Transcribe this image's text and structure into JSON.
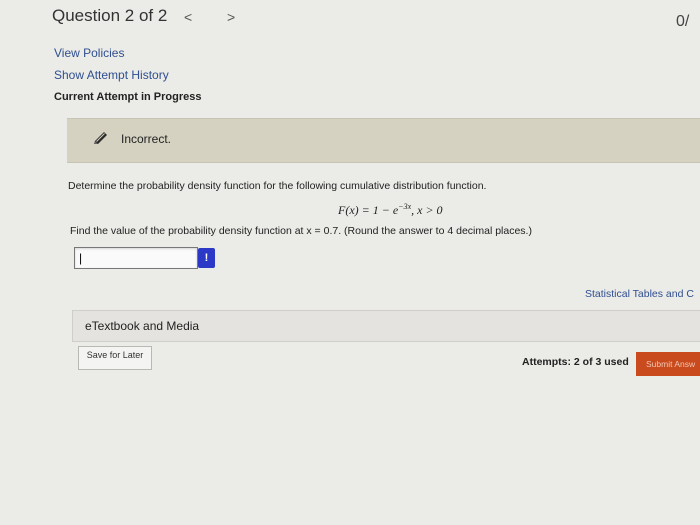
{
  "header": {
    "question_label": "Question 2 of 2",
    "prev_glyph": "<",
    "next_glyph": ">",
    "score": "0/"
  },
  "links": {
    "view_policies": "View Policies",
    "show_attempt_history": "Show Attempt History"
  },
  "attempt_status": "Current Attempt in Progress",
  "feedback": {
    "icon": "pencil-icon",
    "text": "Incorrect."
  },
  "question": {
    "prompt": "Determine the probability density function for the following cumulative distribution function.",
    "formula_lhs": "F(x) = 1 − e",
    "formula_exp": "−3x",
    "formula_rhs": ", x > 0",
    "instruction": "Find the value of the probability density function at x = 0.7. (Round the answer to 4 decimal places.)"
  },
  "answer": {
    "value": "|",
    "status_glyph": "!"
  },
  "resources": {
    "statistical_tables": "Statistical Tables and C",
    "etextbook": "eTextbook and Media"
  },
  "footer": {
    "save_label": "Save for Later",
    "attempts": "Attempts: 2 of 3 used",
    "submit_label": "Submit Answ"
  },
  "colors": {
    "banner": "#d5d2c2",
    "status_blue": "#2c39c6",
    "submit_orange": "#c84a1d"
  }
}
